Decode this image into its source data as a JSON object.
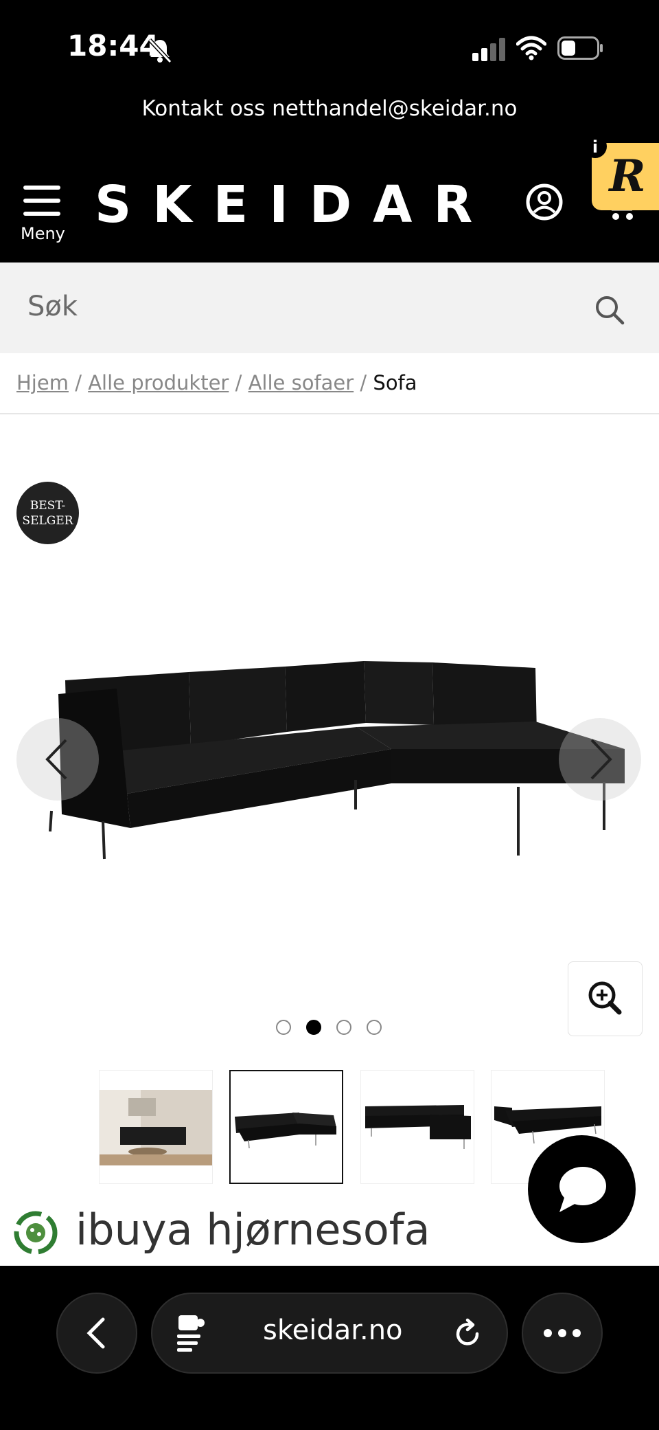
{
  "status_bar": {
    "time": "18:44"
  },
  "header": {
    "contact_text": "Kontakt oss netthandel@skeidar.no",
    "logo": "SKEIDAR",
    "menu_label": "Meny"
  },
  "search": {
    "placeholder": "Søk"
  },
  "breadcrumb": {
    "items": [
      "Hjem",
      "Alle produkter",
      "Alle sofaer"
    ],
    "separator": "/",
    "current": "Sofa"
  },
  "badge": {
    "line1": "BEST-",
    "line2": "SELGER"
  },
  "gallery": {
    "total_images": 4,
    "active_index": 1
  },
  "product": {
    "title": "ibuya hjørnesofa"
  },
  "browser": {
    "url": "skeidar.no"
  },
  "colors": {
    "header_bg": "#000000",
    "search_bg": "#f2f2f2",
    "accent_badge": "#ffd060"
  },
  "icons": [
    "bell-slash-icon",
    "signal-icon",
    "wifi-icon",
    "battery-icon",
    "hamburger-icon",
    "user-icon",
    "cart-icon",
    "search-icon",
    "chevron-left-icon",
    "chevron-right-icon",
    "zoom-in-icon",
    "chat-icon",
    "eco-icon",
    "back-icon",
    "extension-icon",
    "reload-icon",
    "more-icon"
  ]
}
